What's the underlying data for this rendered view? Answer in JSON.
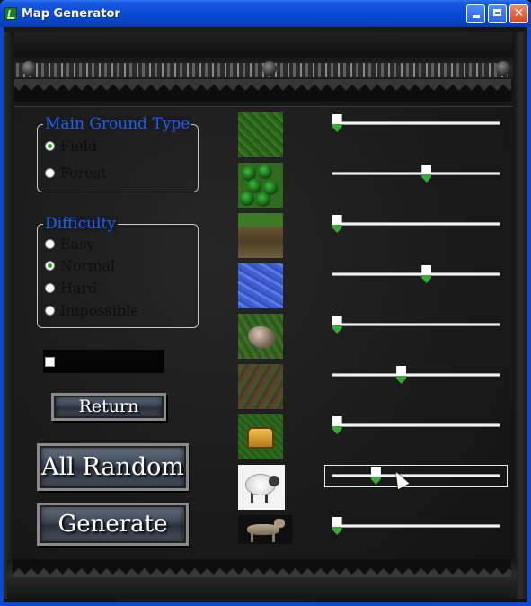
{
  "window": {
    "title": "Map Generator"
  },
  "ground_type": {
    "title": "Main Ground Type",
    "options": [
      {
        "label": "Field",
        "checked": true
      },
      {
        "label": "Forest",
        "checked": false
      }
    ]
  },
  "difficulty": {
    "title": "Difficulty",
    "options": [
      {
        "label": "Easy",
        "checked": false
      },
      {
        "label": "Normal",
        "checked": true
      },
      {
        "label": "Hard",
        "checked": false
      },
      {
        "label": "Impossible",
        "checked": false
      }
    ]
  },
  "option_checkbox": {
    "checked": false
  },
  "buttons": {
    "return": "Return",
    "all_random": "All Random",
    "generate": "Generate"
  },
  "sliders": [
    {
      "icon": "grass-tile-icon",
      "value": 0.03
    },
    {
      "icon": "forest-tile-icon",
      "value": 0.56
    },
    {
      "icon": "mud-tile-icon",
      "value": 0.03
    },
    {
      "icon": "water-tile-icon",
      "value": 0.56
    },
    {
      "icon": "rock-tile-icon",
      "value": 0.03
    },
    {
      "icon": "dirt-tile-icon",
      "value": 0.41
    },
    {
      "icon": "gold-chest-icon",
      "value": 0.03
    },
    {
      "icon": "sheep-icon",
      "value": 0.26
    },
    {
      "icon": "wolf-icon",
      "value": 0.03
    }
  ]
}
